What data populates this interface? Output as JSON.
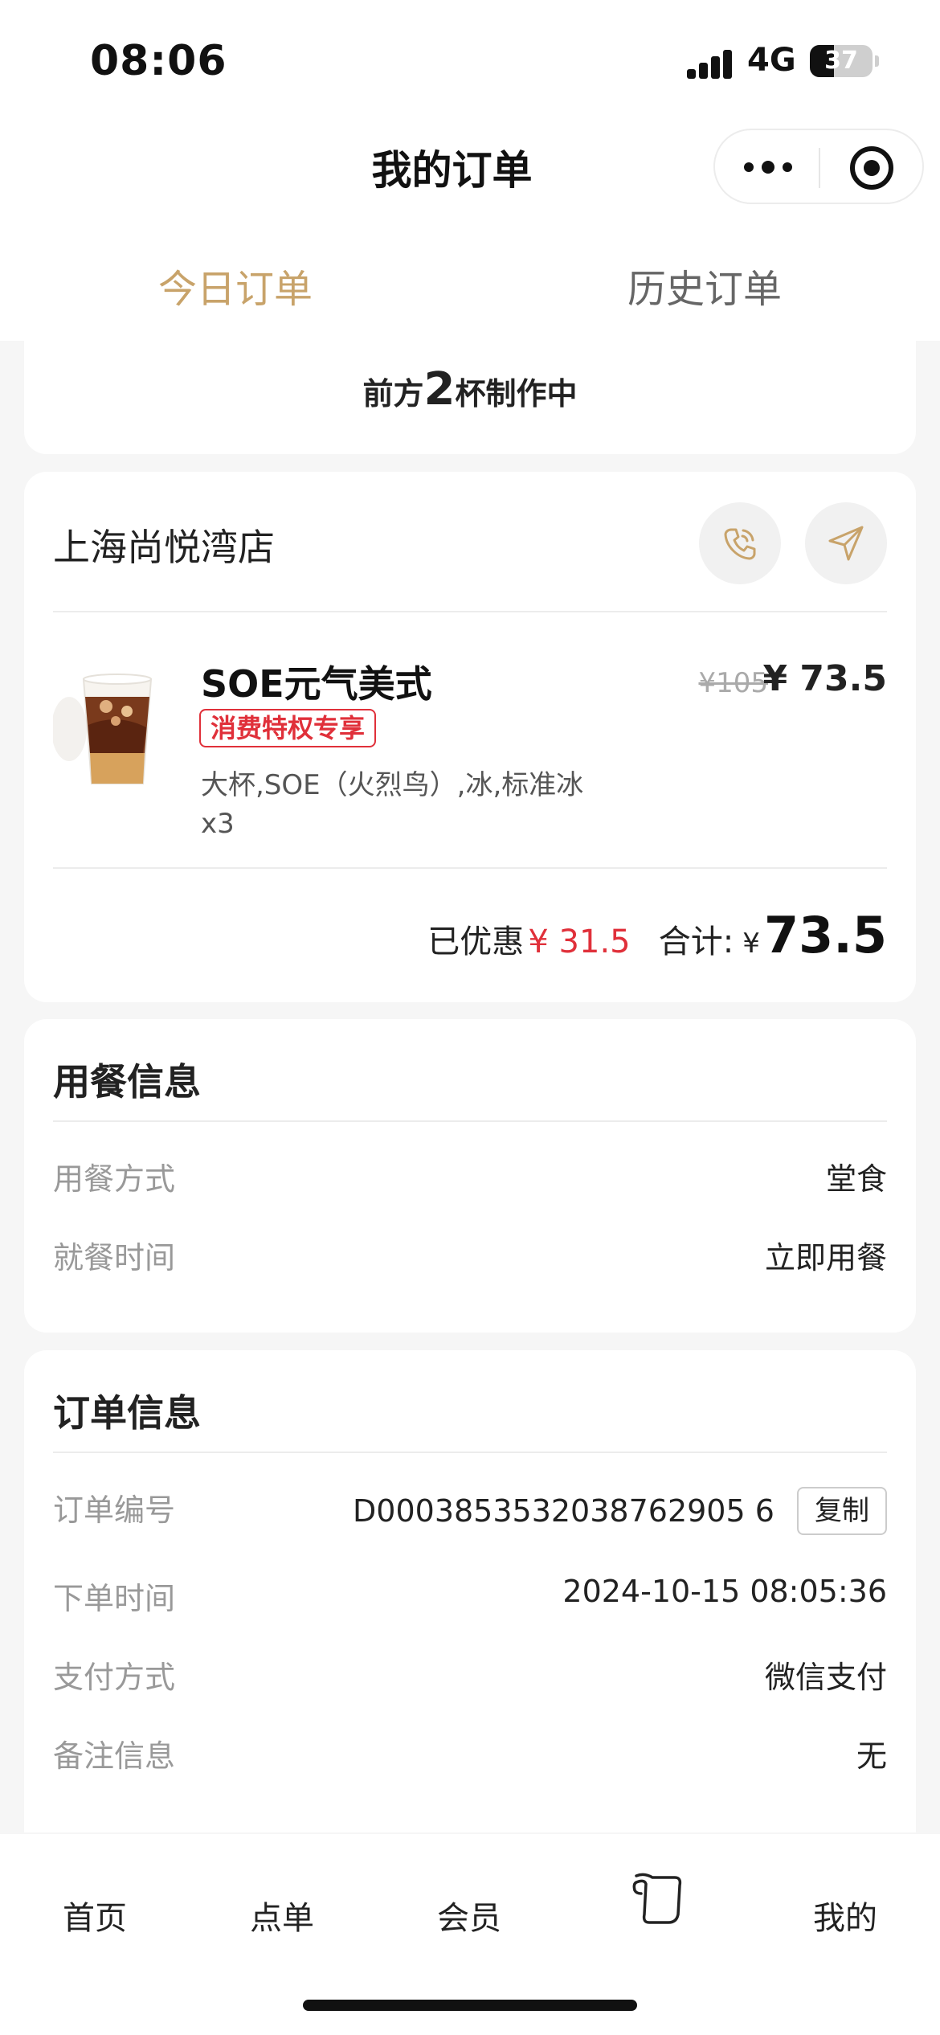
{
  "status_bar": {
    "time": "08:06",
    "network": "4G",
    "battery": "37"
  },
  "nav": {
    "title": "我的订单"
  },
  "tabs": [
    {
      "label": "今日订单",
      "active": true
    },
    {
      "label": "历史订单",
      "active": false
    }
  ],
  "colors": {
    "accent": "#c8a36a",
    "discount_red": "#e0303a"
  },
  "queue": {
    "prefix": "前方",
    "count": "2",
    "suffix": "杯制作中"
  },
  "store": {
    "name": "上海尚悦湾店",
    "icons": [
      "phone-icon",
      "navigate-icon"
    ]
  },
  "item": {
    "name": "SOE元气美式",
    "tag": "消费特权专享",
    "spec": "大杯,SOE（火烈鸟）,冰,标准冰",
    "qty": "x3",
    "original_price": "¥105",
    "price": "¥ 73.5"
  },
  "summary": {
    "discount_label": "已优惠",
    "discount_value": "¥ 31.5",
    "total_label": "合计:",
    "currency": "¥",
    "total": "73.5"
  },
  "dine_info": {
    "title": "用餐信息",
    "rows": [
      {
        "label": "用餐方式",
        "value": "堂食"
      },
      {
        "label": "就餐时间",
        "value": "立即用餐"
      }
    ]
  },
  "order_info": {
    "title": "订单信息",
    "order_no_label": "订单编号",
    "order_no": "D0003853532038762905 6",
    "copy_label": "复制",
    "rows": [
      {
        "label": "下单时间",
        "value": "2024-10-15 08:05:36"
      },
      {
        "label": "支付方式",
        "value": "微信支付"
      },
      {
        "label": "备注信息",
        "value": "无"
      }
    ]
  },
  "tabbar": {
    "items": [
      "首页",
      "点单",
      "会员",
      "",
      "我的"
    ]
  }
}
